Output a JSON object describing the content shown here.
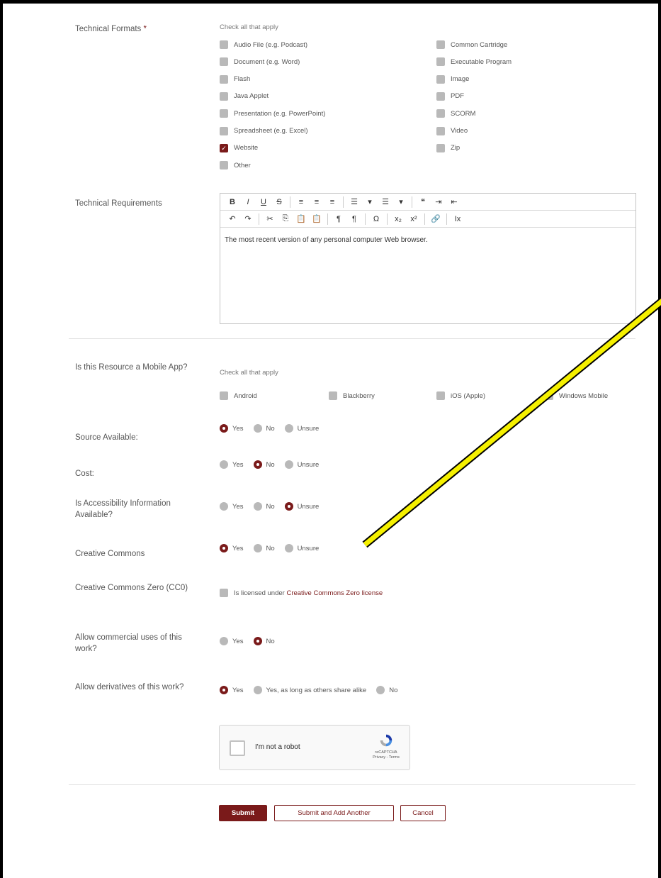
{
  "technical_formats": {
    "label": "Technical Formats",
    "required_mark": "*",
    "hint": "Check all that apply",
    "left": [
      {
        "label": "Audio File (e.g. Podcast)",
        "checked": false
      },
      {
        "label": "Document (e.g. Word)",
        "checked": false
      },
      {
        "label": "Flash",
        "checked": false
      },
      {
        "label": "Java Applet",
        "checked": false
      },
      {
        "label": "Presentation (e.g. PowerPoint)",
        "checked": false
      },
      {
        "label": "Spreadsheet (e.g. Excel)",
        "checked": false
      },
      {
        "label": "Website",
        "checked": true
      },
      {
        "label": "Other",
        "checked": false
      }
    ],
    "right": [
      {
        "label": "Common Cartridge",
        "checked": false
      },
      {
        "label": "Executable Program",
        "checked": false
      },
      {
        "label": "Image",
        "checked": false
      },
      {
        "label": "PDF",
        "checked": false
      },
      {
        "label": "SCORM",
        "checked": false
      },
      {
        "label": "Video",
        "checked": false
      },
      {
        "label": "Zip",
        "checked": false
      }
    ]
  },
  "technical_requirements": {
    "label": "Technical Requirements",
    "toolbar_row1": [
      "B",
      "I",
      "U",
      "S",
      "|",
      "≡",
      "≡",
      "≡",
      "|",
      "☰",
      "▾",
      "☰",
      "▾",
      "|",
      "❝",
      "⇥",
      "⇤"
    ],
    "toolbar_row2": [
      "↶",
      "↷",
      "|",
      "✂",
      "⎘",
      "📋",
      "📋",
      "|",
      "¶",
      "¶",
      "|",
      "Ω",
      "|",
      "x₂",
      "x²",
      "|",
      "🔗",
      "|",
      "Ix"
    ],
    "content": "The most recent version of any personal computer Web browser."
  },
  "mobile_app": {
    "label": "Is this Resource a Mobile App?",
    "hint": "Check all that apply",
    "options": [
      {
        "label": "Android",
        "checked": false
      },
      {
        "label": "Blackberry",
        "checked": false
      },
      {
        "label": "iOS (Apple)",
        "checked": false
      },
      {
        "label": "Windows Mobile",
        "checked": false
      }
    ]
  },
  "source_available": {
    "label": "Source Available:",
    "options": [
      "Yes",
      "No",
      "Unsure"
    ],
    "selected": "Yes"
  },
  "cost": {
    "label": "Cost:",
    "options": [
      "Yes",
      "No",
      "Unsure"
    ],
    "selected": "No"
  },
  "accessibility": {
    "label": "Is Accessibility Information Available?",
    "options": [
      "Yes",
      "No",
      "Unsure"
    ],
    "selected": "Unsure"
  },
  "creative_commons": {
    "label": "Creative Commons",
    "options": [
      "Yes",
      "No",
      "Unsure"
    ],
    "selected": "Yes"
  },
  "cc_zero": {
    "label": "Creative Commons Zero (CC0)",
    "prefix": "Is licensed under",
    "link": "Creative Commons Zero license",
    "checked": false
  },
  "commercial": {
    "label": "Allow commercial uses of this work?",
    "options": [
      "Yes",
      "No"
    ],
    "selected": "No"
  },
  "derivatives": {
    "label": "Allow derivatives of this work?",
    "options": [
      "Yes",
      "Yes, as long as others share alike",
      "No"
    ],
    "selected": "Yes"
  },
  "captcha": {
    "label": "I'm not a robot",
    "brand": "reCAPTCHA",
    "links": "Privacy - Terms"
  },
  "buttons": {
    "submit": "Submit",
    "submit_add": "Submit and Add Another",
    "cancel": "Cancel"
  },
  "colors": {
    "accent": "#7a1a1a",
    "annotation_arrow": "#f5f000"
  }
}
